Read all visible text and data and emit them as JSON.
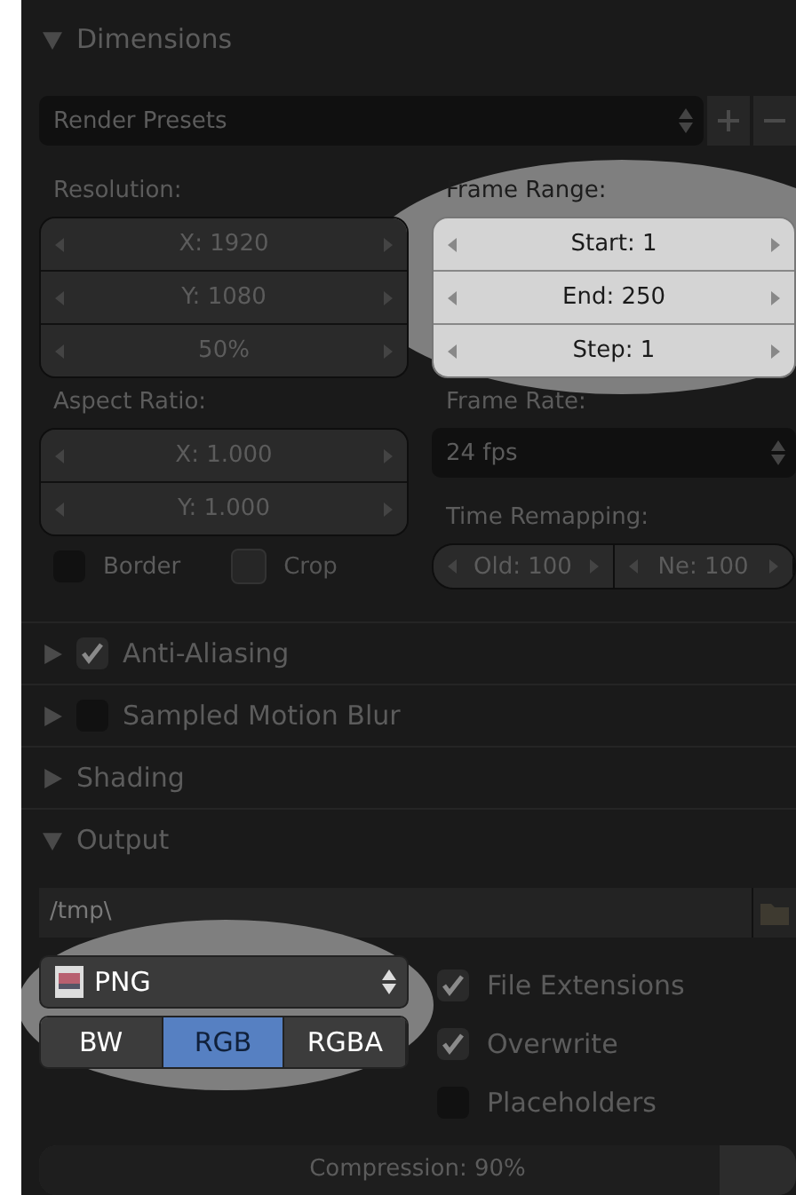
{
  "dimensions": {
    "title": "Dimensions",
    "expanded": true,
    "render_presets": {
      "value": "Render Presets"
    },
    "resolution": {
      "label": "Resolution:",
      "fields": [
        "X: 1920",
        "Y: 1080",
        "50%"
      ]
    },
    "frame_range": {
      "label": "Frame Range:",
      "highlighted": true,
      "fields": [
        "Start: 1",
        "End: 250",
        "Step: 1"
      ]
    },
    "aspect_ratio": {
      "label": "Aspect Ratio:",
      "fields": [
        "X: 1.000",
        "Y: 1.000"
      ]
    },
    "frame_rate": {
      "label": "Frame Rate:",
      "value": "24 fps"
    },
    "time_remapping": {
      "label": "Time Remapping:",
      "fields": [
        "Old: 100",
        "Ne: 100"
      ]
    },
    "toggles": [
      {
        "label": "Border",
        "checked": false,
        "disabled": false
      },
      {
        "label": "Crop",
        "checked": false,
        "disabled": true
      }
    ]
  },
  "panels": [
    {
      "title": "Anti-Aliasing",
      "expanded": false,
      "checked": true
    },
    {
      "title": "Sampled Motion Blur",
      "expanded": false,
      "checked": false
    },
    {
      "title": "Shading",
      "expanded": false
    }
  ],
  "output": {
    "title": "Output",
    "expanded": true,
    "path": "/tmp\\",
    "format": {
      "value": "PNG",
      "highlighted": true
    },
    "color_modes": [
      {
        "label": "BW",
        "selected": false
      },
      {
        "label": "RGB",
        "selected": true
      },
      {
        "label": "RGBA",
        "selected": false
      }
    ],
    "options": [
      {
        "label": "File Extensions",
        "checked": true
      },
      {
        "label": "Overwrite",
        "checked": true
      },
      {
        "label": "Placeholders",
        "checked": false
      }
    ],
    "compression": {
      "label": "Compression: 90%",
      "level": 0.9
    }
  }
}
